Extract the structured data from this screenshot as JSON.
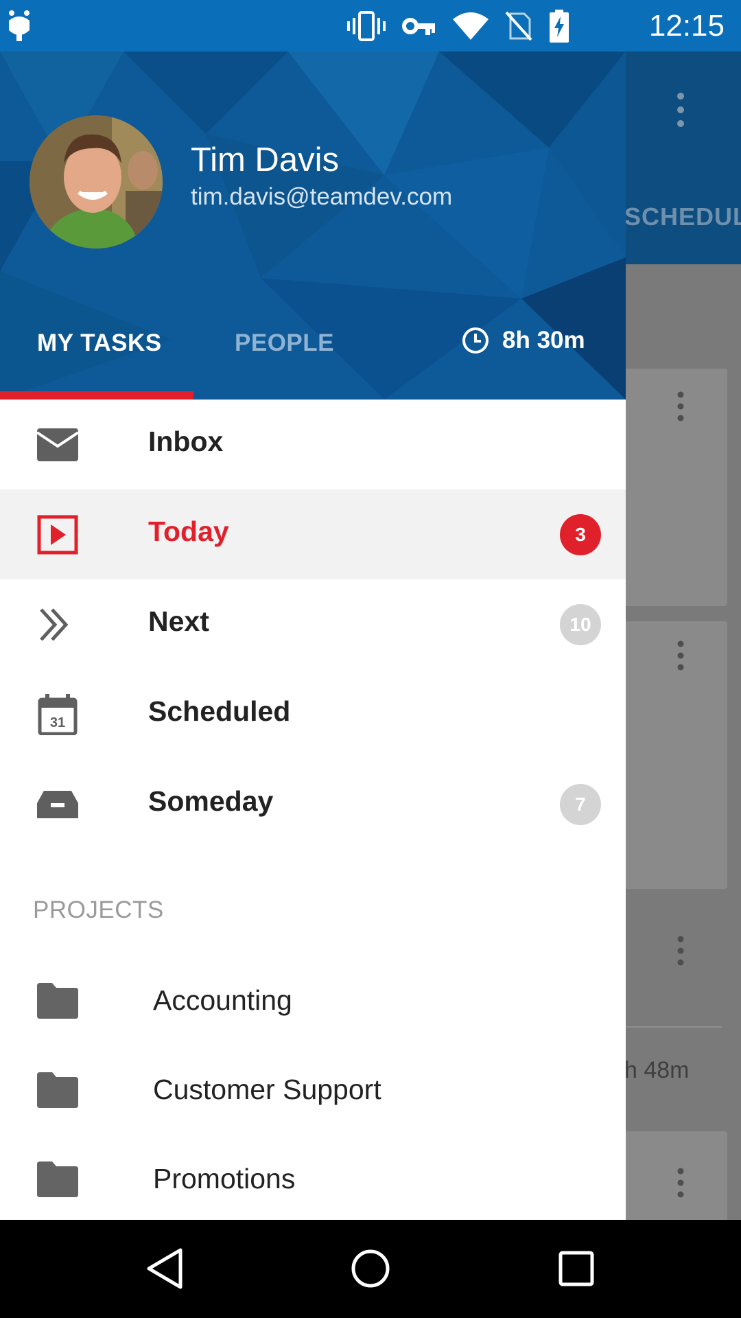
{
  "status_bar": {
    "time": "12:15",
    "icons": [
      "android-debug-icon",
      "vibrate-icon",
      "vpn-key-icon",
      "wifi-icon",
      "no-sim-icon",
      "battery-charging-icon"
    ]
  },
  "background_app": {
    "tab_label": "SCHEDULE",
    "row_time": "h 48m"
  },
  "drawer": {
    "header": {
      "user_name": "Tim Davis",
      "user_email": "tim.davis@teamdev.com",
      "tabs": [
        {
          "label": "MY TASKS",
          "selected": true
        },
        {
          "label": "PEOPLE",
          "selected": false
        }
      ],
      "timer": "8h 30m"
    },
    "items": [
      {
        "label": "Inbox",
        "icon": "mail-icon",
        "badge": null
      },
      {
        "label": "Today",
        "icon": "play-box-icon",
        "badge": "3",
        "active": true
      },
      {
        "label": "Next",
        "icon": "double-chevron-right-icon",
        "badge": "10"
      },
      {
        "label": "Scheduled",
        "icon": "calendar-icon",
        "badge": null,
        "icon_text": "31"
      },
      {
        "label": "Someday",
        "icon": "inbox-tray-icon",
        "badge": "7"
      }
    ],
    "projects_title": "PROJECTS",
    "projects": [
      {
        "label": "Accounting",
        "icon": "folder-icon"
      },
      {
        "label": "Customer Support",
        "icon": "folder-icon"
      },
      {
        "label": "Promotions",
        "icon": "folder-icon"
      }
    ]
  },
  "colors": {
    "primary": "#0e5a98",
    "status_bar": "#0a6fb8",
    "accent": "#e0212b",
    "badge_grey": "#d4d4d4"
  },
  "nav_bar": [
    "back-icon",
    "home-icon",
    "recents-icon"
  ]
}
